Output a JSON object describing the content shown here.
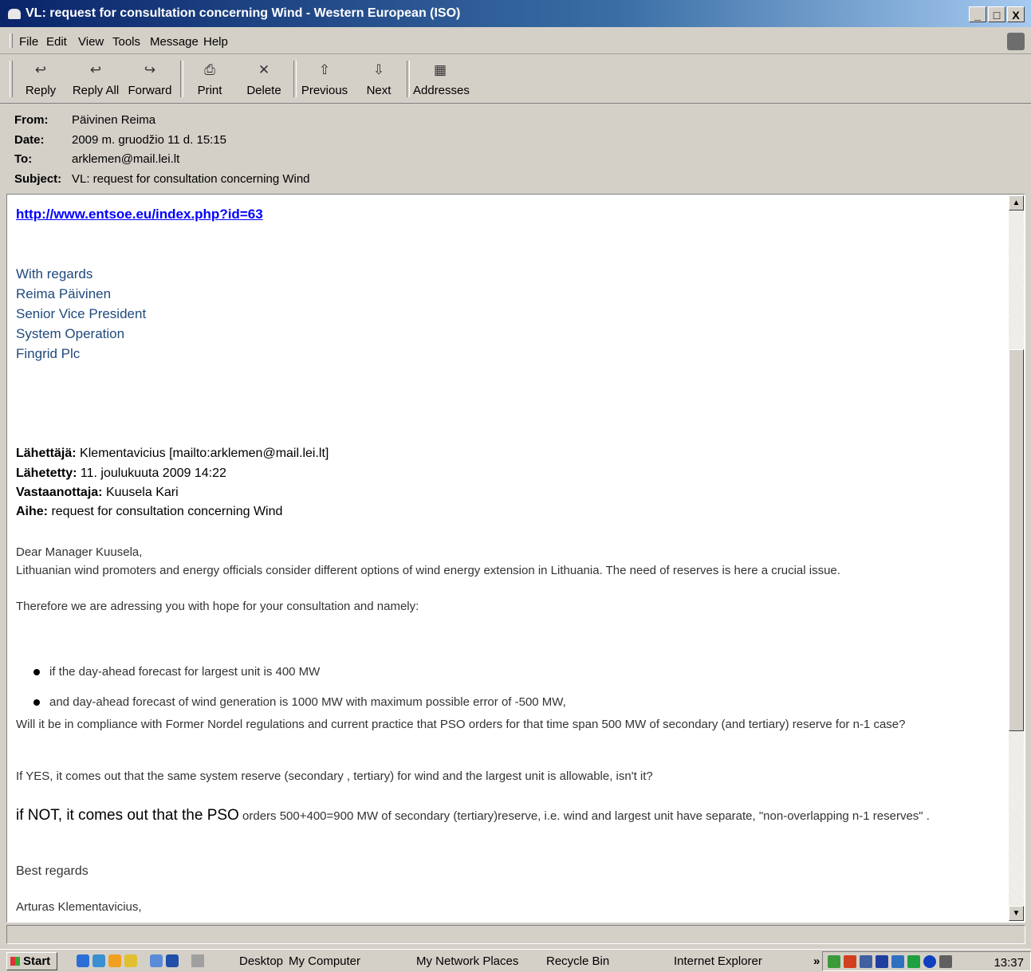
{
  "window": {
    "title": "VL: request for consultation concerning Wind - Western European (ISO)",
    "controls": [
      "_",
      "□",
      "X"
    ]
  },
  "menubar": [
    "File",
    "Edit",
    "View",
    "Tools",
    "Message",
    "Help"
  ],
  "toolbar": [
    {
      "label": "Reply",
      "icon": "reply-icon",
      "glyph": "↩"
    },
    {
      "label": "Reply All",
      "icon": "reply-all-icon",
      "glyph": "↩"
    },
    {
      "label": "Forward",
      "icon": "forward-icon",
      "glyph": "↪"
    },
    {
      "label": "Print",
      "icon": "printer-icon",
      "glyph": "⎙"
    },
    {
      "label": "Delete",
      "icon": "delete-icon",
      "glyph": "✕"
    },
    {
      "label": "Previous",
      "icon": "up-arrow-icon",
      "glyph": "⇧"
    },
    {
      "label": "Next",
      "icon": "down-arrow-icon",
      "glyph": "⇩"
    },
    {
      "label": "Addresses",
      "icon": "address-book-icon",
      "glyph": "▦"
    }
  ],
  "header": {
    "from_label": "From:",
    "from": "Päivinen Reima",
    "date_label": "Date:",
    "date": "2009 m. gruodžio 11 d. 15:15",
    "to_label": "To:",
    "to": "arklemen@mail.lei.lt",
    "subject_label": "Subject:",
    "subject": "VL: request for consultation concerning Wind"
  },
  "message": {
    "link": "http://www.entsoe.eu/index.php?id=63",
    "signature": [
      "With regards",
      "Reima Päivinen",
      "Senior Vice President",
      "System Operation",
      "Fingrid Plc"
    ],
    "forward_header": {
      "sender_label": "Lähettäjä:",
      "sender": "Klementavicius [mailto:arklemen@mail.lei.lt]",
      "sent_label": "Lähetetty:",
      "sent": "11. joulukuuta 2009 14:22",
      "recipient_label": "Vastaanottaja:",
      "recipient": "Kuusela Kari",
      "subject_label": "Aihe:",
      "subject": "request for consultation concerning Wind"
    },
    "greeting": "Dear Manager Kuusela,",
    "p1": "Lithuanian wind promoters and energy officials consider different options of wind energy extension in Lithuania. The need of reserves is here a crucial issue.",
    "p2": "Therefore we are adressing you with hope for your consultation and namely:",
    "bullet1": "if the day-ahead forecast for largest unit is 400 MW",
    "bullet2": "and day-ahead forecast of wind generation is 1000 MW with maximum possible error of -500 MW,",
    "p3": "Will it be in compliance with Former Nordel regulations and current practice that PSO orders for that time span 500 MW of secondary  (and tertiary) reserve for n-1 case?",
    "p4": "If YES, it comes out that the same system reserve (secondary , tertiary) for wind and the largest unit is allowable, isn't it?",
    "p5_big": "if NOT, it comes out that the PSO",
    "p5_rest": " orders 500+400=900 MW of secondary (tertiary)reserve, i.e. wind and largest unit have separate, \"non-overlapping n-1 reserves\" .",
    "closing": "Best regards",
    "name": "Arturas Klementavicius,"
  },
  "taskbar": {
    "start": "Start",
    "items": [
      "Desktop",
      "My Computer",
      "My Network Places",
      "Recycle Bin",
      "Internet Explorer"
    ],
    "chevron": "»",
    "clock": "13:37"
  }
}
